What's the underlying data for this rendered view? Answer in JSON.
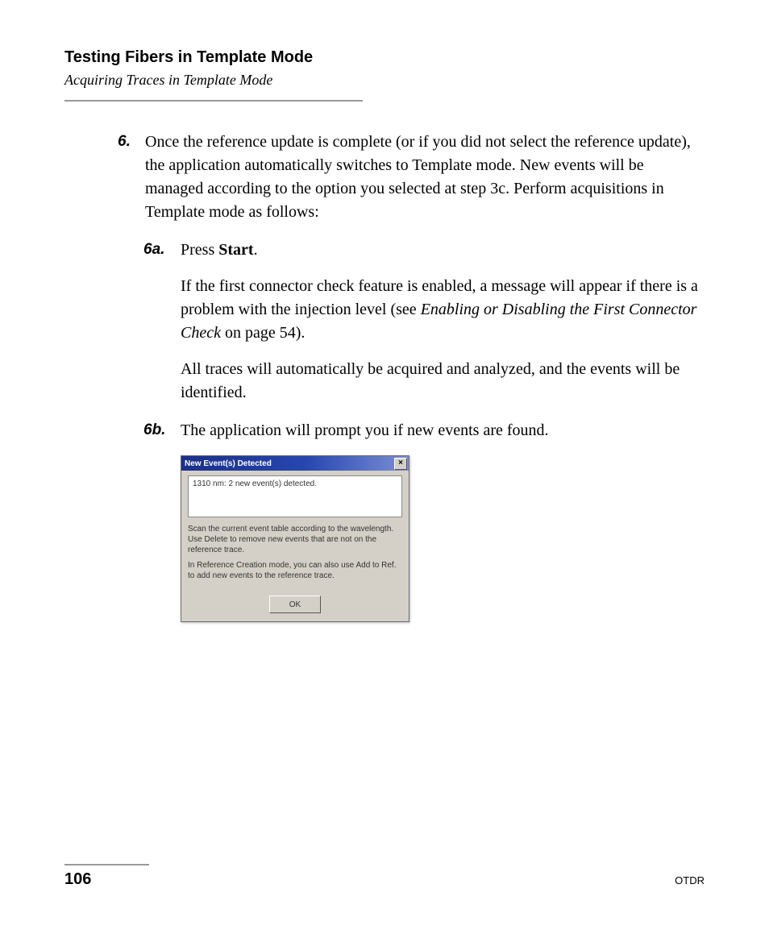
{
  "header": {
    "chapter": "Testing Fibers in Template Mode",
    "section": "Acquiring Traces in Template Mode"
  },
  "step6": {
    "num": "6.",
    "text": "Once the reference update is complete (or if you did not select the reference update), the application automatically switches to Template mode. New events will be managed according to the option you selected at step 3c. Perform acquisitions in Template mode as follows:"
  },
  "step6a": {
    "num": "6a.",
    "line1_pre": "Press ",
    "line1_strong": "Start",
    "line1_post": ".",
    "para2_pre": "If the first connector check feature is enabled, a message will appear if there is a problem with the injection level (see ",
    "para2_em": "Enabling or Disabling the First Connector Check",
    "para2_post": " on page 54).",
    "para3": "All traces will automatically be acquired and analyzed, and the events will be identified."
  },
  "step6b": {
    "num": "6b.",
    "text": "The application will prompt you if new events are found."
  },
  "dialog": {
    "title": "New Event(s) Detected",
    "close_glyph": "×",
    "detected_line": "1310 nm: 2 new event(s) detected.",
    "msg1": "Scan the current event table according to the wavelength. Use Delete to remove new events that are not on the reference trace.",
    "msg2": "In Reference Creation mode, you can also use Add to Ref. to add new events to the reference trace.",
    "ok": "OK"
  },
  "footer": {
    "page": "106",
    "doc": "OTDR"
  }
}
